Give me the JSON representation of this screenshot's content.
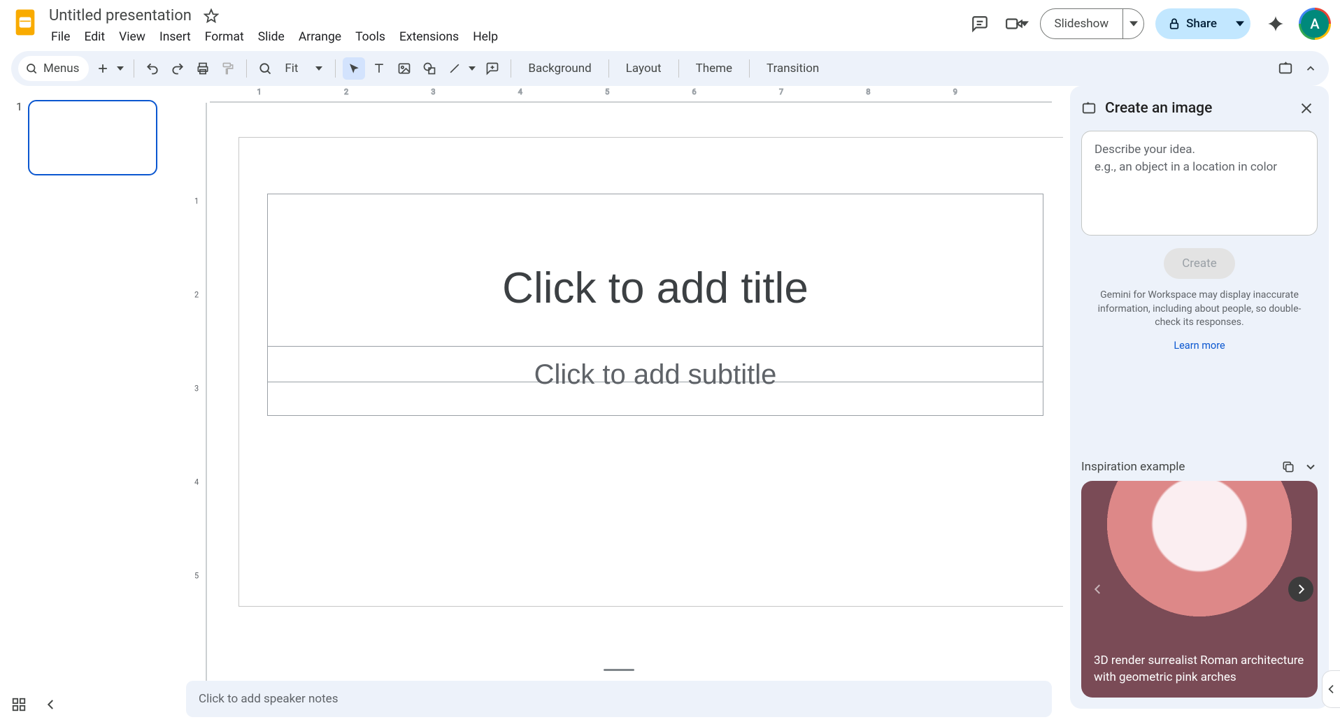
{
  "header": {
    "doc_title": "Untitled presentation",
    "menus": [
      "File",
      "Edit",
      "View",
      "Insert",
      "Format",
      "Slide",
      "Arrange",
      "Tools",
      "Extensions",
      "Help"
    ],
    "slideshow_label": "Slideshow",
    "share_label": "Share",
    "avatar_initial": "A"
  },
  "toolbar": {
    "menus_label": "Menus",
    "zoom_label": "Fit",
    "background_label": "Background",
    "layout_label": "Layout",
    "theme_label": "Theme",
    "transition_label": "Transition"
  },
  "filmstrip": {
    "slide_number": "1"
  },
  "canvas": {
    "title_placeholder": "Click to add title",
    "subtitle_placeholder": "Click to add subtitle"
  },
  "notes": {
    "placeholder": "Click to add speaker notes"
  },
  "side_panel": {
    "title": "Create an image",
    "prompt_line1": "Describe your idea.",
    "prompt_line2": "e.g., an object in a location in color",
    "create_label": "Create",
    "disclaimer": "Gemini for Workspace may display inaccurate information, including about people, so double-check its responses.",
    "learn_more": "Learn more",
    "inspiration_title": "Inspiration example",
    "inspiration_caption": "3D render surrealist Roman architecture with geometric pink arches"
  },
  "ruler": {
    "h_labels": [
      "1",
      "2",
      "3",
      "4",
      "5",
      "6",
      "7",
      "8",
      "9"
    ],
    "v_labels": [
      "1",
      "2",
      "3",
      "4",
      "5"
    ]
  }
}
